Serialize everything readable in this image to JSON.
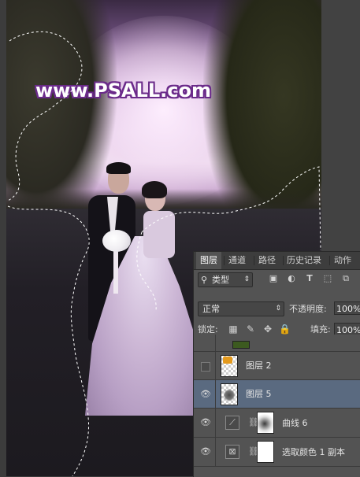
{
  "canvas": {
    "watermark": "www.PSALL.com"
  },
  "layers_panel": {
    "tabs": [
      {
        "label": "图层",
        "active": true
      },
      {
        "label": "通道",
        "active": false
      },
      {
        "label": "路径",
        "active": false
      },
      {
        "label": "历史记录",
        "active": false
      },
      {
        "label": "动作",
        "active": false
      }
    ],
    "filter": {
      "label": "类型",
      "arrow": "⇕"
    },
    "filter_icons": [
      "image-filter-icon",
      "adjustment-filter-icon",
      "type-filter-icon",
      "shape-filter-icon",
      "smart-object-filter-icon"
    ],
    "blend_mode": "正常",
    "opacity_label": "不透明度:",
    "opacity_value": "100%",
    "lock_label": "锁定:",
    "lock_icons": [
      "lock-transparent-icon",
      "lock-image-icon",
      "lock-position-icon",
      "lock-all-icon"
    ],
    "fill_label": "填充:",
    "fill_value": "100%",
    "layers": [
      {
        "name": "",
        "visible": false,
        "thumb": "green"
      },
      {
        "name": "图层 2",
        "visible": false,
        "thumb": "orange"
      },
      {
        "name": "图层 5",
        "visible": true,
        "thumb": "blob",
        "selected": true
      },
      {
        "name": "曲线 6",
        "visible": true,
        "thumb": "curves-adjustment",
        "mask": "curve"
      },
      {
        "name": "选取颜色 1 副本",
        "visible": true,
        "thumb": "selective-color-adjustment",
        "mask": "white"
      }
    ]
  },
  "icons": {
    "eye": "eye-icon",
    "chain": "link-icon"
  }
}
